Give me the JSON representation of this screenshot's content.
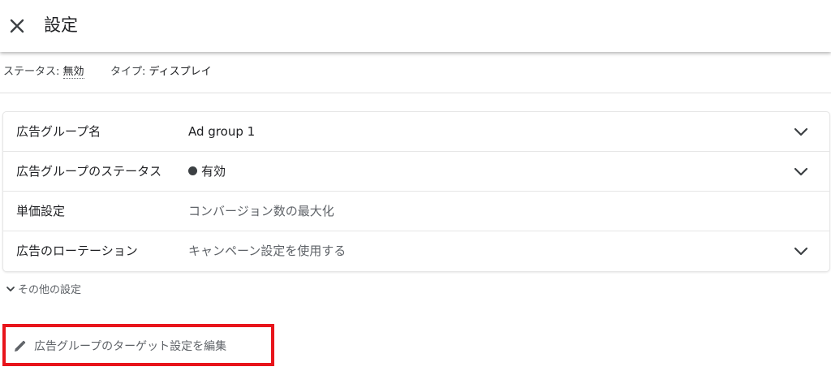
{
  "header": {
    "title": "設定",
    "close_icon": "close-icon"
  },
  "status_bar": {
    "status_label": "ステータス: ",
    "status_value": "無効",
    "type_label": "タイプ: ",
    "type_value": "ディスプレイ"
  },
  "settings": {
    "rows": [
      {
        "label": "広告グループ名",
        "value": "Ad group 1",
        "expandable": true
      },
      {
        "label": "広告グループのステータス",
        "value": "有効",
        "status_dot_color": "#3c4043",
        "expandable": true
      },
      {
        "label": "単価設定",
        "value": "コンバージョン数の最大化",
        "expandable": false
      },
      {
        "label": "広告のローテーション",
        "value": "キャンペーン設定を使用する",
        "expandable": true
      }
    ]
  },
  "more_settings": {
    "label": "その他の設定",
    "icon": "chevron-down-icon"
  },
  "edit_targeting": {
    "label": "広告グループのターゲット設定を編集",
    "icon": "pencil-icon",
    "highlight_color": "#e8141b"
  }
}
